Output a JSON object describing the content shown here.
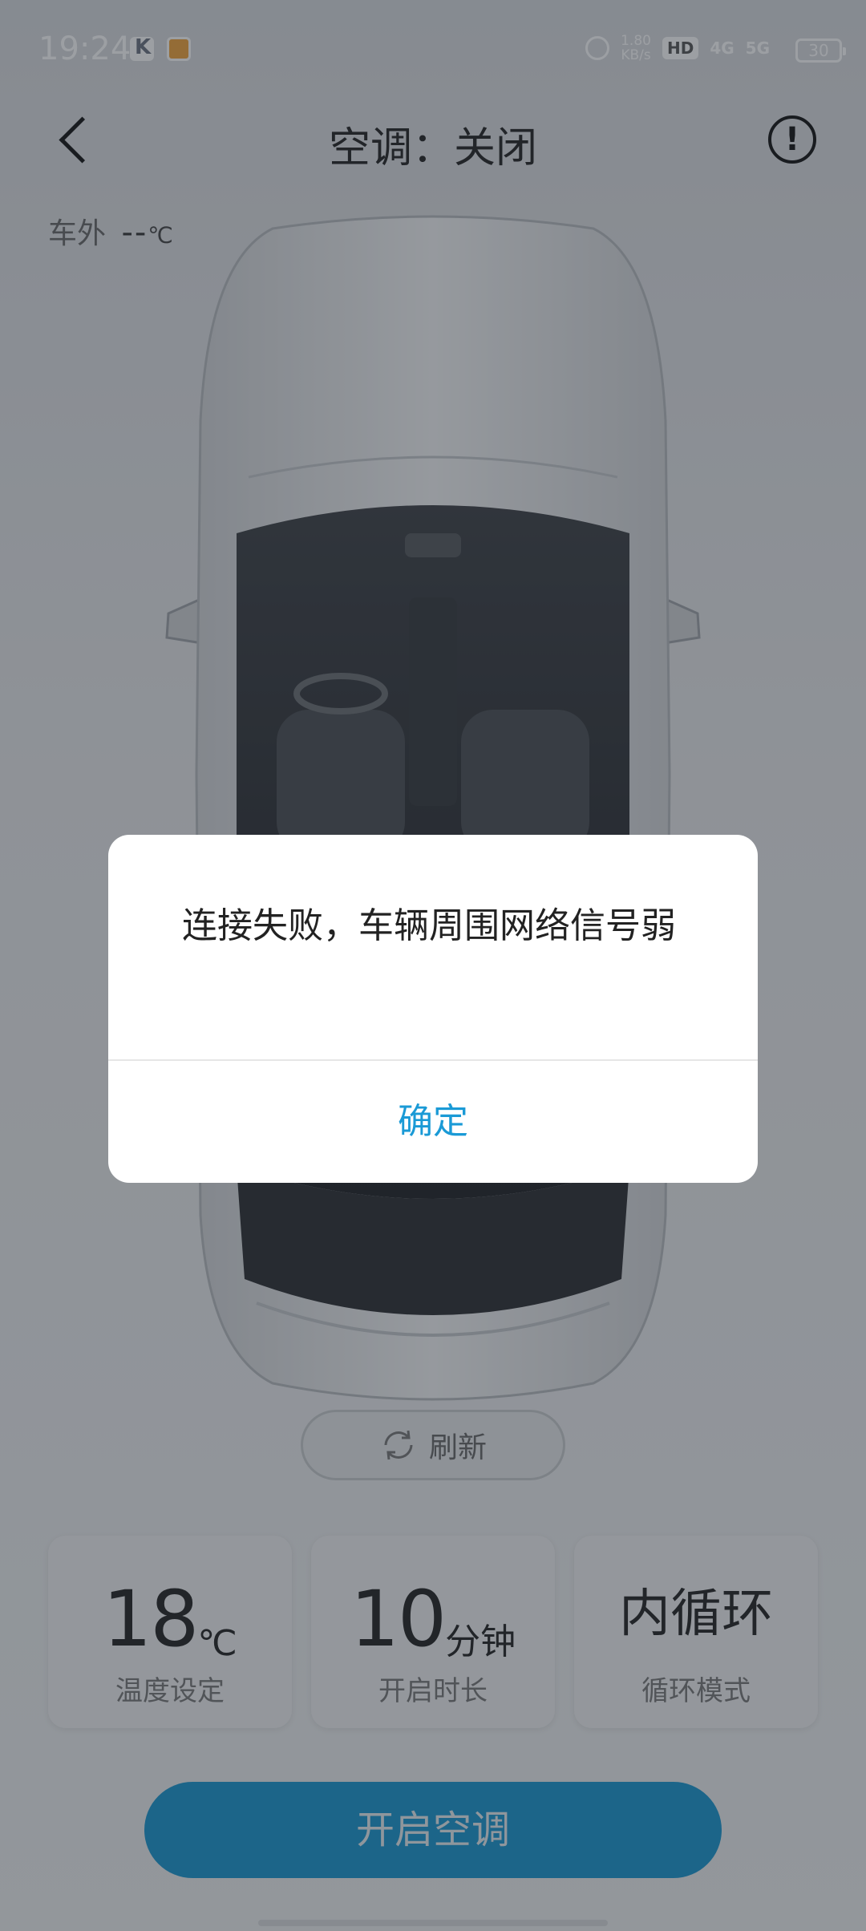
{
  "status_bar": {
    "time": "19:24",
    "net_speed": "1.80",
    "net_speed_unit": "KB/s",
    "hd_label": "HD",
    "signal_1": "4G",
    "signal_2": "5G",
    "battery": "30"
  },
  "header": {
    "title": "空调：关闭",
    "info_icon": "!"
  },
  "outside_temp": {
    "label": "车外",
    "value": "--",
    "unit": "℃"
  },
  "refresh": {
    "label": "刷新"
  },
  "cards": [
    {
      "value": "18",
      "unit": "℃",
      "label": "温度设定"
    },
    {
      "value": "10",
      "unit": "分钟",
      "label": "开启时长"
    },
    {
      "value": "内循环",
      "label": "循环模式"
    }
  ],
  "start_button": {
    "label": "开启空调"
  },
  "dialog": {
    "message": "连接失败，车辆周围网络信号弱",
    "confirm_label": "确定"
  },
  "colors": {
    "accent": "#1a9ad6",
    "primary_button": "#1795cf",
    "overlay": "rgba(35,42,52,0.45)"
  }
}
